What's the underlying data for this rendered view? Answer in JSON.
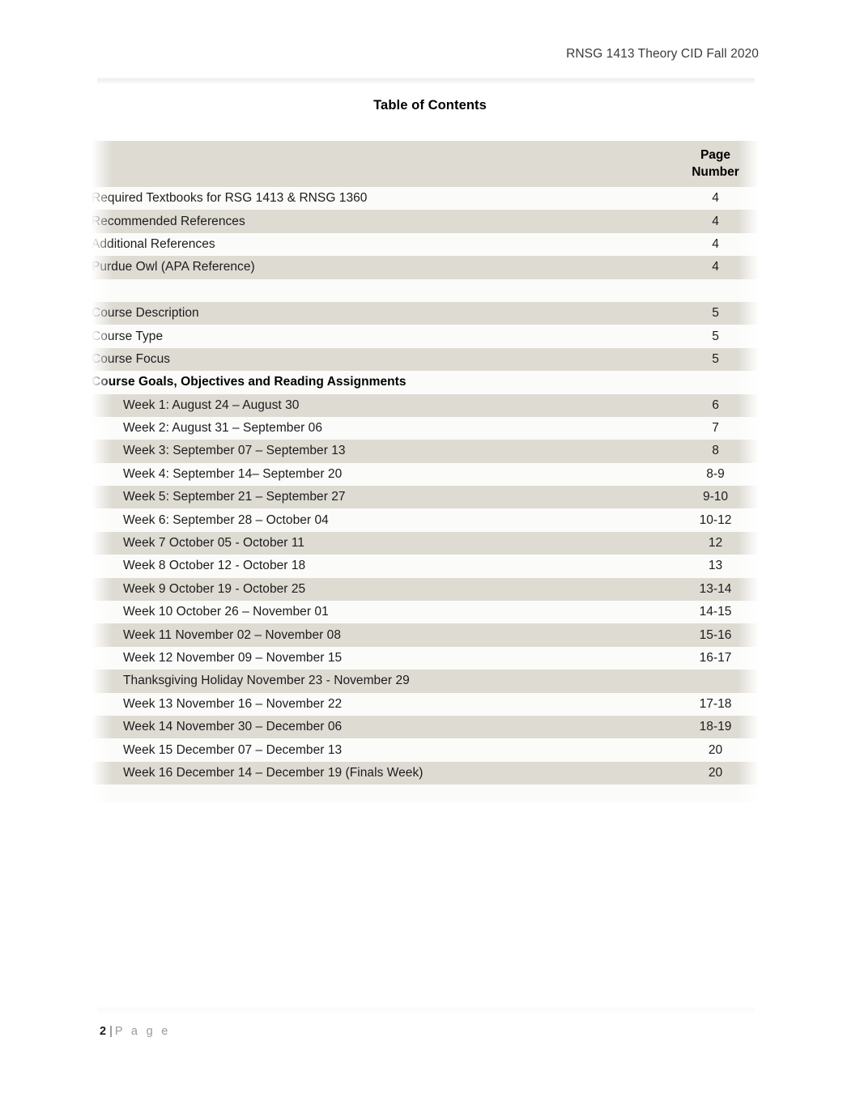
{
  "document": {
    "running_header": "RNSG 1413 Theory CID Fall 2020",
    "title": "Table of Contents"
  },
  "toc_table": {
    "columns": {
      "label_header": "",
      "page_header_line1": "Page",
      "page_header_line2": "Number"
    },
    "rows": [
      {
        "kind": "item",
        "label": "Required Textbooks for RSG 1413 & RNSG 1360",
        "page": "4"
      },
      {
        "kind": "item",
        "label": "Recommended References",
        "page": "4"
      },
      {
        "kind": "item",
        "label": "Additional References",
        "page": "4"
      },
      {
        "kind": "item",
        "label": "Purdue Owl (APA Reference)",
        "page": "4"
      },
      {
        "kind": "spacer",
        "label": "",
        "page": ""
      },
      {
        "kind": "item",
        "label": "Course Description",
        "page": "5"
      },
      {
        "kind": "item",
        "label": "Course Type",
        "page": "5"
      },
      {
        "kind": "item",
        "label": "Course Focus",
        "page": "5"
      },
      {
        "kind": "heading",
        "label": "Course Goals, Objectives and Reading Assignments",
        "page": ""
      },
      {
        "kind": "sub",
        "label": "Week 1: August 24 – August 30",
        "page": "6"
      },
      {
        "kind": "sub",
        "label": "Week 2: August 31 – September 06",
        "page": "7"
      },
      {
        "kind": "sub",
        "label": "Week 3: September 07 – September 13",
        "page": "8"
      },
      {
        "kind": "sub",
        "label": "Week 4: September 14– September 20",
        "page": "8-9"
      },
      {
        "kind": "sub",
        "label": "Week 5: September 21 – September 27",
        "page": "9-10"
      },
      {
        "kind": "sub",
        "label": "Week 6: September 28 – October 04",
        "page": "10-12"
      },
      {
        "kind": "sub",
        "label": "Week 7 October 05 - October 11",
        "page": "12"
      },
      {
        "kind": "sub",
        "label": "Week 8 October 12 - October 18",
        "page": "13"
      },
      {
        "kind": "sub",
        "label": "Week 9 October 19 - October 25",
        "page": "13-14"
      },
      {
        "kind": "sub",
        "label": "Week 10 October 26 – November 01",
        "page": "14-15"
      },
      {
        "kind": "sub",
        "label": "Week 11 November 02 – November 08",
        "page": "15-16"
      },
      {
        "kind": "sub",
        "label": "Week 12 November 09 – November 15",
        "page": "16-17"
      },
      {
        "kind": "sub",
        "label": "Thanksgiving Holiday November 23 - November 29",
        "page": ""
      },
      {
        "kind": "sub",
        "label": "Week 13 November 16 – November 22",
        "page": "17-18"
      },
      {
        "kind": "sub",
        "label": "Week 14 November 30 – December 06",
        "page": "18-19"
      },
      {
        "kind": "sub",
        "label": "Week 15 December 07 – December 13",
        "page": "20"
      },
      {
        "kind": "sub",
        "label": "Week 16 December 14 – December 19 (Finals Week)",
        "page": "20"
      },
      {
        "kind": "tail",
        "label": "",
        "page": ""
      }
    ]
  },
  "footer": {
    "page_number": "2",
    "separator": "|",
    "page_word": "P a g e"
  },
  "colors": {
    "band_shaded": "#dedbd3",
    "band_light": "#fbfbf9",
    "text": "#1c1c1c",
    "header_text": "#3b3b3b",
    "footer_muted": "#9a9a9a"
  }
}
